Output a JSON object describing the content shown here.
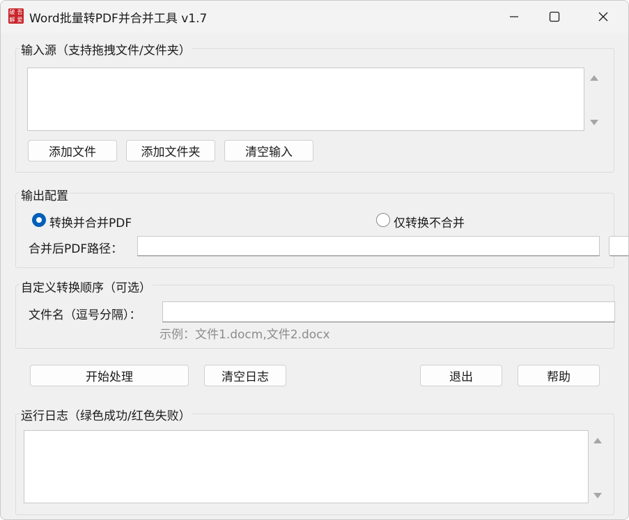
{
  "window": {
    "title": "Word批量转PDF并合并工具 v1.7",
    "icon_glyphs": [
      "破",
      "吾",
      "解",
      "爱"
    ]
  },
  "input_group": {
    "label": "输入源（支持拖拽文件/文件夹）",
    "add_file_label": "添加文件",
    "add_folder_label": "添加文件夹",
    "clear_input_label": "清空输入"
  },
  "output_group": {
    "label": "输出配置",
    "radio_merge_label": "转换并合并PDF",
    "radio_convert_only_label": "仅转换不合并",
    "selected_mode": "merge",
    "merged_path_label": "合并后PDF路径：",
    "merged_path_value": ""
  },
  "order_group": {
    "label": "自定义转换顺序（可选）",
    "filename_label": "文件名（逗号分隔）：",
    "filename_value": "",
    "example_hint": "示例：文件1.docm,文件2.docx"
  },
  "actions": {
    "start_label": "开始处理",
    "clear_log_label": "清空日志",
    "exit_label": "退出",
    "help_label": "帮助"
  },
  "log_group": {
    "label": "运行日志（绿色成功/红色失败）"
  },
  "colors": {
    "accent": "#005fb8",
    "window_bg": "#f0f0f0",
    "hint_text": "#8c8c8c",
    "icon_red": "#c8252b"
  }
}
